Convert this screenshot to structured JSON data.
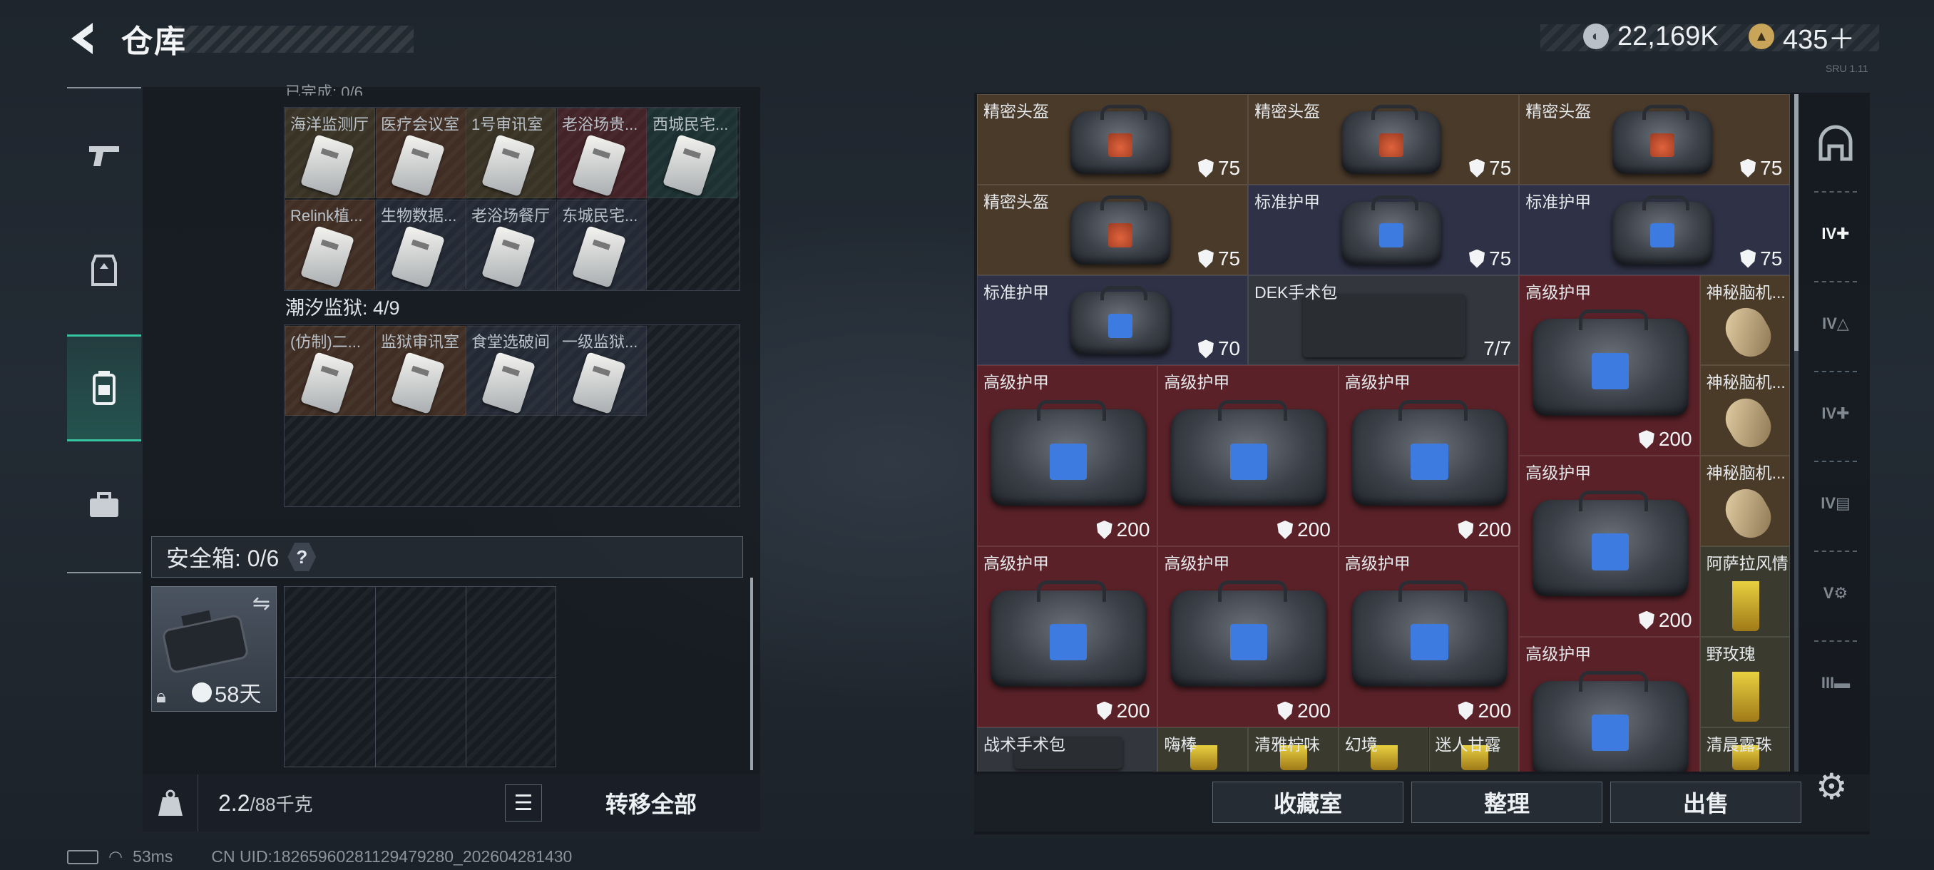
{
  "header": {
    "title": "仓库",
    "currency_a": "22,169K",
    "currency_b": "435＋",
    "build_text": "SRU 1.11"
  },
  "left_nav": {
    "items": [
      {
        "name": "weapons"
      },
      {
        "name": "equipment"
      },
      {
        "name": "backpack",
        "active": true
      },
      {
        "name": "case"
      }
    ]
  },
  "keycards": {
    "partial_header": "已完成: 0/6",
    "rows": [
      [
        "海洋监测厅",
        "医疗会议室",
        "1号审讯室",
        "老浴场贵...",
        "西城民宅..."
      ],
      [
        "Relink植...",
        "生物数据...",
        "老浴场餐厅",
        "东城民宅..."
      ]
    ],
    "section2_title": "潮汐监狱: 4/9",
    "section2_cards": [
      "(仿制)二...",
      "监狱审讯室",
      "食堂选破间",
      "一级监狱..."
    ]
  },
  "safebox": {
    "label": "安全箱: 0/6",
    "help": "?",
    "time_left": "58天"
  },
  "bottom_left": {
    "weight": "2.2",
    "weight_max": "/88千克",
    "transfer_all": "转移全部"
  },
  "items": [
    {
      "name": "精密头盔",
      "value": "75",
      "type": "helmet"
    },
    {
      "name": "精密头盔",
      "value": "75",
      "type": "helmet"
    },
    {
      "name": "精密头盔",
      "value": "75",
      "type": "helmet"
    },
    {
      "name": "精密头盔",
      "value": "75",
      "type": "helmet"
    },
    {
      "name": "标准护甲",
      "value": "75",
      "type": "armor"
    },
    {
      "name": "标准护甲",
      "value": "75",
      "type": "armor"
    },
    {
      "name": "标准护甲",
      "value": "70",
      "type": "armor"
    },
    {
      "name": "DEK手术包",
      "value": "7/7",
      "type": "medkit"
    },
    {
      "name": "高级护甲",
      "value": "200",
      "type": "heavy"
    },
    {
      "name": "神秘脑机...",
      "value": "",
      "type": "misc"
    },
    {
      "name": "高级护甲",
      "value": "200",
      "type": "heavy"
    },
    {
      "name": "高级护甲",
      "value": "200",
      "type": "heavy"
    },
    {
      "name": "高级护甲",
      "value": "200",
      "type": "heavy"
    },
    {
      "name": "神秘脑机...",
      "value": "",
      "type": "misc"
    },
    {
      "name": "高级护甲",
      "value": "200",
      "type": "heavy"
    },
    {
      "name": "神秘脑机...",
      "value": "",
      "type": "misc"
    },
    {
      "name": "高级护甲",
      "value": "200",
      "type": "heavy"
    },
    {
      "name": "高级护甲",
      "value": "200",
      "type": "heavy"
    },
    {
      "name": "高级护甲",
      "value": "200",
      "type": "heavy"
    },
    {
      "name": "阿萨拉风情",
      "value": "",
      "type": "drink"
    },
    {
      "name": "高级护甲",
      "value": "",
      "type": "heavy"
    },
    {
      "name": "野玫瑰",
      "value": "",
      "type": "drink"
    },
    {
      "name": "战术手术包",
      "value": "",
      "type": "medkit"
    },
    {
      "name": "嗨棒",
      "value": "",
      "type": "drink"
    },
    {
      "name": "清雅柠味",
      "value": "",
      "type": "drink"
    },
    {
      "name": "幻境",
      "value": "",
      "type": "drink"
    },
    {
      "name": "迷人甘露",
      "value": "",
      "type": "drink"
    },
    {
      "name": "清晨露珠",
      "value": "",
      "type": "drink"
    }
  ],
  "actions": {
    "collection": "收藏室",
    "sort": "整理",
    "sell": "出售"
  },
  "right_nav": {
    "items": [
      {
        "name": "all"
      },
      {
        "name": "IV medical"
      },
      {
        "name": "IV armor"
      },
      {
        "name": "IV medical 2"
      },
      {
        "name": "IV folder"
      },
      {
        "name": "V device"
      },
      {
        "name": "III weapon"
      }
    ]
  },
  "status": {
    "ping": "53ms",
    "uid": "CN UID:18265960281129479280_202604281430"
  },
  "colors": {
    "accent": "#37c3a0",
    "rarity_gold": "#4a3a28",
    "rarity_purple": "#2e2f48",
    "rarity_red": "#5a2228"
  }
}
